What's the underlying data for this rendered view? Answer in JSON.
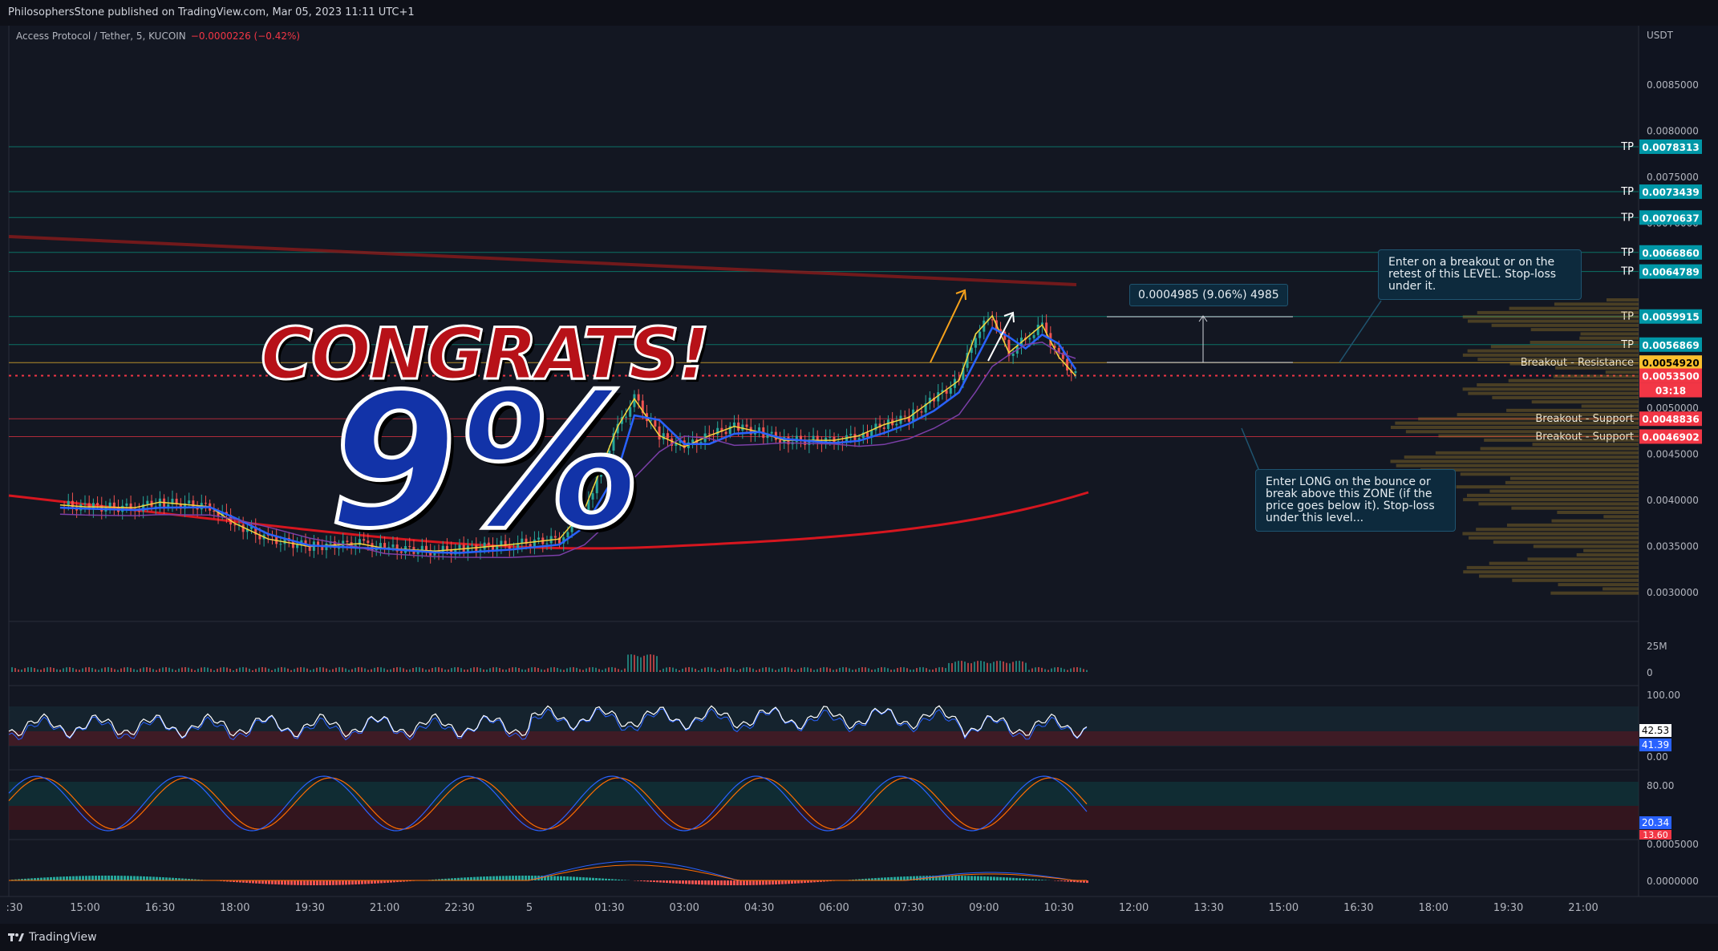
{
  "header": {
    "published": "PhilosophersStone published on TradingView.com, Mar 05, 2023 11:11 UTC+1"
  },
  "symbol": {
    "name": "Access Protocol / Tether, 5, KUCOIN",
    "change": "−0.0000226 (−0.42%)"
  },
  "footer": {
    "brand": "TradingView"
  },
  "overlay": {
    "congrats": "CONGRATS!",
    "percent": "9%"
  },
  "measure_label": "0.0004985 (9.06%) 4985",
  "notes": {
    "resistance": "Enter on a breakout or on the retest of this LEVEL. Stop-loss under it.",
    "support": "Enter LONG on the bounce or break above this ZONE (if the price goes below it). Stop-loss under this level..."
  },
  "chart_data": {
    "type": "candlestick",
    "currency": "USDT",
    "price_axis": [
      "0.0085000",
      "0.0080000",
      "0.0075000",
      "0.0070000",
      "0.0065000",
      "0.0060000",
      "0.0055000",
      "0.0050000",
      "0.0045000",
      "0.0040000",
      "0.0035000",
      "0.0030000"
    ],
    "time_axis": [
      ":30",
      "15:00",
      "16:30",
      "18:00",
      "19:30",
      "21:00",
      "22:30",
      "5",
      "01:30",
      "03:00",
      "04:30",
      "06:00",
      "07:30",
      "09:00",
      "10:30",
      "12:00",
      "13:30",
      "15:00",
      "16:30",
      "18:00",
      "19:30",
      "21:00"
    ],
    "levels": [
      {
        "label": "TP",
        "price": "0.0078313",
        "color": "#089981"
      },
      {
        "label": "TP",
        "price": "0.0073439",
        "color": "#089981"
      },
      {
        "label": "TP",
        "price": "0.0070637",
        "color": "#089981"
      },
      {
        "label": "TP",
        "price": "0.0066860",
        "color": "#089981"
      },
      {
        "label": "TP",
        "price": "0.0064789",
        "color": "#089981"
      },
      {
        "label": "TP",
        "price": "0.0059915",
        "color": "#089981"
      },
      {
        "label": "TP",
        "price": "0.0056869",
        "color": "#089981"
      },
      {
        "label": "Breakout - Resistance",
        "price": "0.0054920",
        "color": "#fbc02d"
      },
      {
        "label": "",
        "price": "0.0053500",
        "color": "#f23645"
      },
      {
        "label": "Breakout - Support",
        "price": "0.0048836",
        "color": "#f23645"
      },
      {
        "label": "Breakout - Support",
        "price": "0.0046902",
        "color": "#f23645"
      }
    ],
    "countdown": "03:18",
    "close_trend": [
      [
        "14:30",
        0.00395
      ],
      [
        "15:00",
        0.00393
      ],
      [
        "16:00",
        0.00392
      ],
      [
        "16:30",
        0.00398
      ],
      [
        "17:30",
        0.00393
      ],
      [
        "18:00",
        0.00375
      ],
      [
        "18:40",
        0.00358
      ],
      [
        "19:30",
        0.0035
      ],
      [
        "20:30",
        0.00353
      ],
      [
        "21:00",
        0.00348
      ],
      [
        "22:00",
        0.00345
      ],
      [
        "22:30",
        0.00347
      ],
      [
        "23:30",
        0.00352
      ],
      [
        "00:30",
        0.00358
      ],
      [
        "01:00",
        0.0039
      ],
      [
        "01:40",
        0.0048
      ],
      [
        "02:00",
        0.0051
      ],
      [
        "02:30",
        0.0047
      ],
      [
        "03:00",
        0.00458
      ],
      [
        "03:30",
        0.0047
      ],
      [
        "04:00",
        0.0048
      ],
      [
        "04:30",
        0.00474
      ],
      [
        "05:00",
        0.00465
      ],
      [
        "06:00",
        0.00465
      ],
      [
        "06:30",
        0.0047
      ],
      [
        "07:00",
        0.00482
      ],
      [
        "07:30",
        0.0049
      ],
      [
        "08:00",
        0.0051
      ],
      [
        "08:30",
        0.0053
      ],
      [
        "08:50",
        0.0058
      ],
      [
        "09:10",
        0.006
      ],
      [
        "09:30",
        0.0056
      ],
      [
        "09:50",
        0.00575
      ],
      [
        "10:10",
        0.0059
      ],
      [
        "10:30",
        0.00555
      ],
      [
        "10:50",
        0.00535
      ]
    ],
    "volume_axis": [
      "25M",
      "0"
    ],
    "rsi": {
      "axis": [
        "100.00",
        "0.00"
      ],
      "values": [
        "42.53",
        "41.39"
      ]
    },
    "stoch": {
      "axis": [
        "80.00"
      ],
      "values": [
        "20.34",
        "13.60"
      ]
    },
    "macd": {
      "axis": [
        "0.0005000",
        "0.0000000"
      ]
    }
  }
}
